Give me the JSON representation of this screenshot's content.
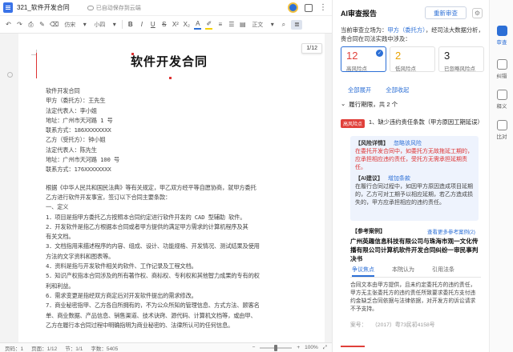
{
  "titlebar": {
    "doc_title": "321_软件开发合同",
    "save_status": "已自动保存到云端"
  },
  "toolbar": {
    "font_name": "仿宋",
    "font_size": "小四",
    "style_label": "正文"
  },
  "page_indicator": "1/12",
  "document": {
    "heading": "软件开发合同",
    "lines": [
      "软件开发合同",
      "甲方（委托方）：王先生",
      "法定代表人：李小姐",
      "地址：广州市天河路 1 号",
      "联系方式：186XXXXXXXX",
      "乙方（受托方）：钟小姐",
      "法定代表人：陈先生",
      "地址：广州市天河路 100 号",
      "联系方式：176XXXXXXXX"
    ],
    "paragraphs": [
      "根据《中华人民共和国民法典》等有关规定，甲乙双方经平等自愿协商，就甲方委托",
      "乙方进行软件开发事宜，签订以下合同主要条款：",
      "一、定义",
      "1．项目是指甲方委托乙方按照本合同约定进行软件开发的  CAD 型辅助     软件。",
      "2．开发软件是指乙方根据本合同或者甲方提供的满足甲方需求的计算机程序及其",
      "有关文档。",
      "3．文档指用来描述程序的内容、组成、设计、功能规格、开发情况、测试结果及使用",
      "方法的文字资料和图表等。",
      "4．资料是指与开发软件相关的软件、工作记录及工程文档。",
      "5．知识产权指本合同涉及的所有著作权、商标权、专利权和其他智力成果的专有的权",
      "利和利益。",
      "6．需求变更是指经双方商定后对开发软件提出的需求修改。",
      "7．商业秘密指甲、乙方各自所拥有的，不为公众所知的管理信息、方式方法、顾客名",
      "单、商业数据、产品信息、销售渠道、技术诀窍、源代码、计算机文档等，或由甲、",
      "乙方在履行本合同过程中明确指明为商业秘密的、法律所认可的任何信息。"
    ]
  },
  "statusbar": {
    "page": "页码：1",
    "pages": "页面：1/12",
    "section": "节：1/1",
    "words": "字数：5405",
    "zoom": "100%"
  },
  "panel": {
    "title": "AI审查报告",
    "recheck_label": "重新审查",
    "stance_prefix": "当前审查立场为：",
    "stance_value": "甲方（委托方）",
    "stance_suffix": "，经司法大数据分析，贵合同在司法实践中涉及：",
    "risks": [
      {
        "count": "12",
        "label": "高风险点",
        "color": "#e0403a"
      },
      {
        "count": "2",
        "label": "低风险点",
        "color": "#e8a200"
      },
      {
        "count": "3",
        "label": "已忽略风险点",
        "color": "#222"
      }
    ],
    "expand_all": "全部展开",
    "collapse_all": "全部收起",
    "section": "履行期限，共 2 个",
    "issue_tag": "高风险点",
    "issue_title": "1、缺少违约责任条款（甲方原因工期延误）",
    "detail_label": "【风险详情】",
    "detail_ignore": "忽略该风险",
    "detail_text": "在委托开发合同中，如委托方无故拖延工期的，应承担相应违约责任，受托方无需承担延期责任。",
    "ai_label": "【AI建议】",
    "ai_link": "增加条款",
    "ai_text": "在履行合同过程中，如因甲方原因造成项目延期的，乙方可对工期予以相应延期，若乙方造成损失的，甲方应承担相应的违约责任。",
    "case_label": "【参考案例】",
    "case_more": "查看更多参考案例(2)",
    "case_title": "广州英趣信息科技有限公司与珠海市观一文化传播有限公司计算机软件开发合同纠纷一审民事判决书",
    "case_tabs": [
      "争议焦点",
      "本院认为",
      "引用法条"
    ],
    "case_body": "合同文本由甲方提供，且未约定委托方的违约责任，甲方无主张委托方的违约责任所致要求委托方支付违约金缺乏合同依据与法律依据，对开发方的诉讼请求不予支持。",
    "case_no_label": "案号：",
    "case_no": "（2017）粤73民初4158号"
  },
  "rail": [
    "审查",
    "纠错",
    "释义",
    "比对"
  ]
}
